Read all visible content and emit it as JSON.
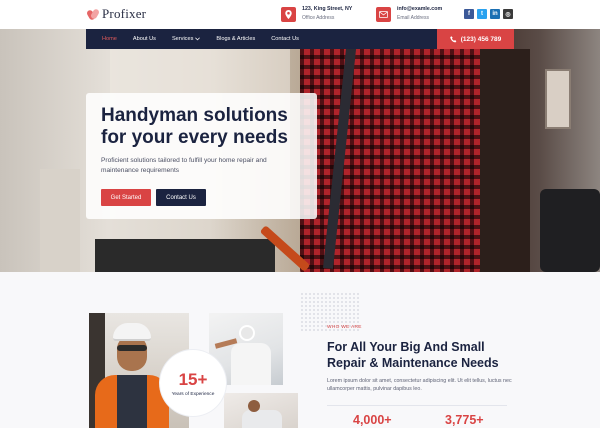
{
  "brand": {
    "name": "Profixer"
  },
  "header": {
    "address": {
      "line1": "123, King Street, NY",
      "line2": "Office Address",
      "icon": "location-pin-icon"
    },
    "email": {
      "line1": "info@examle.com",
      "line2": "Email Address",
      "icon": "mail-icon"
    },
    "socials": [
      {
        "label": "f",
        "icon": "facebook-icon"
      },
      {
        "label": "t",
        "icon": "twitter-icon"
      },
      {
        "label": "in",
        "icon": "linkedin-icon"
      },
      {
        "label": "◎",
        "icon": "instagram-icon"
      }
    ]
  },
  "nav": {
    "items": [
      {
        "label": "Home",
        "active": true
      },
      {
        "label": "About Us"
      },
      {
        "label": "Services",
        "has_dropdown": true
      },
      {
        "label": "Blogs & Articles"
      },
      {
        "label": "Contact Us"
      }
    ],
    "phone": "(123) 456 789"
  },
  "hero": {
    "title": "Handyman solutions for your every needs",
    "subtitle": "Proficient solutions tailored to fulfill your home repair and maintenance requirements",
    "primary_button": "Get Started",
    "secondary_button": "Contact Us"
  },
  "about": {
    "experience_value": "15+",
    "experience_label": "Years of Experience",
    "eyebrow": "WHO WE ARE",
    "title": "For All Your Big And Small Repair & Maintenance Needs",
    "text": "Lorem ipsum dolor sit amet, consectetur adipiscing elit. Ut elit tellus, luctus nec ullamcorper mattis, pulvinar dapibus leo.",
    "stats": [
      "4,000+",
      "3,775+"
    ]
  },
  "colors": {
    "accent": "#d94444",
    "navy": "#1b2340"
  }
}
